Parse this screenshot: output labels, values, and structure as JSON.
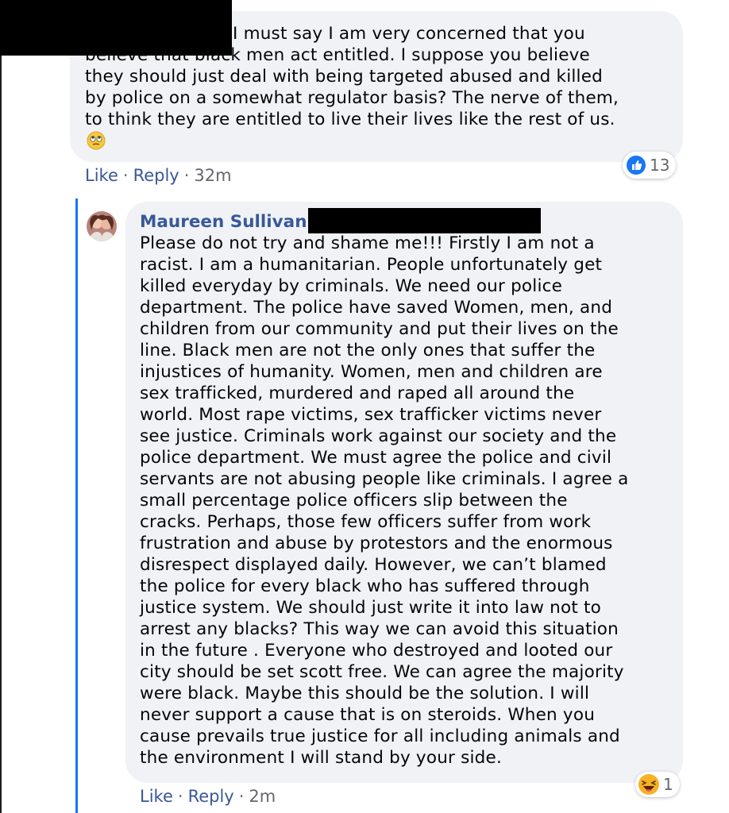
{
  "comments": [
    {
      "text": "I must say I am very concerned that you\nbelieve that black men act entitled. I suppose you believe\nthey should just deal with being targeted abused and killed\nby police on a somewhat regulator basis? The nerve of them,\nto think they are entitled to live their lives like the rest of us.",
      "emoji_icon": "rolling-eyes-emoji",
      "actions": {
        "like": "Like",
        "reply": "Reply",
        "time": "32m",
        "separator": "·"
      },
      "reaction": {
        "icon": "like-thumb-icon",
        "count": "13"
      }
    },
    {
      "author": "Maureen Sullivan",
      "text": "Please do not try and shame me!!! Firstly I am not a\nracist. I am a humanitarian. People unfortunately get\nkilled everyday by criminals. We need our police\ndepartment. The police have saved Women, men, and\nchildren from our community and put their lives on the\nline. Black men are not the only ones that suffer the\ninjustices of humanity. Women, men and children are\nsex trafficked, murdered and raped all around the\nworld. Most rape victims, sex trafficker victims never\nsee justice. Criminals work against our society and the\npolice department. We must agree the police and civil\nservants are not abusing people like criminals. I agree a\nsmall percentage police officers slip between the\ncracks. Perhaps, those few officers suffer from work\nfrustration and abuse by protestors and the enormous\ndisrespect displayed daily. However, we can’t blamed\nthe police for every black who has suffered through\njustice system. We should just write it into law not to\narrest any blacks? This way we can avoid this situation\nin the future . Everyone who destroyed and looted our\ncity should be set scott free. We can agree the majority\nwere black. Maybe this should be the solution. I will\nnever support a cause that is on steroids. When you\ncause prevails true justice for all including animals and\nthe environment I will stand by your side.",
      "actions": {
        "like": "Like",
        "reply": "Reply",
        "time": "2m",
        "separator": "·"
      },
      "reaction": {
        "icon": "haha-laughing-emoji",
        "count": "1"
      }
    }
  ],
  "colors": {
    "link": "#385898",
    "meta": "#65676b",
    "bubble": "#f0f2f5",
    "thread_line": "#1877f2",
    "like_blue": "#1877f2",
    "haha_yellow": "#f7b125"
  }
}
